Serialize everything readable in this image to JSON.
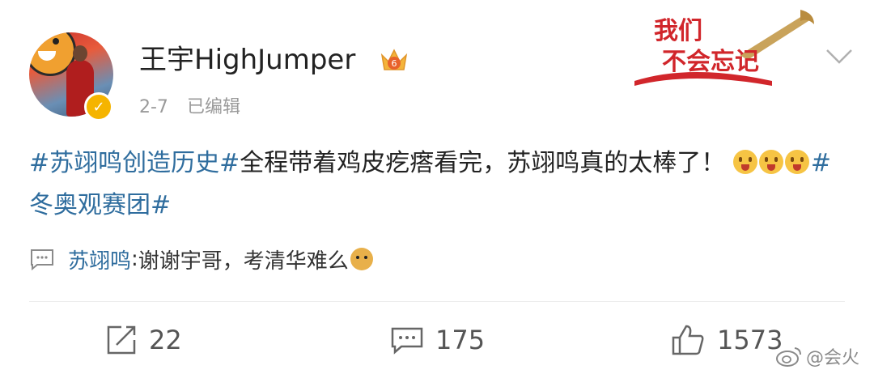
{
  "post": {
    "username": "王宇HighJumper",
    "date": "2-7",
    "edited_label": "已编辑",
    "vip_level": "6",
    "badge_text_line1": "我们",
    "badge_text_line2": "不会忘记",
    "content": {
      "tag1": "#苏翊鸣创造历史#",
      "text1": "全程带着鸡皮疙瘩看完，苏翊鸣真的太棒了！",
      "tag2": "#冬奥观赛团#"
    },
    "comment": {
      "name": "苏翊鸣",
      "separator": ": ",
      "text": "谢谢宇哥，考清华难么"
    }
  },
  "actions": {
    "repost_count": "22",
    "comment_count": "175",
    "like_count": "1573"
  },
  "watermark": {
    "text": "@会火"
  },
  "colors": {
    "link": "#2f6d9e",
    "muted": "#9a9a9a",
    "verified": "#f5b400",
    "badge_red": "#d1262b"
  },
  "icons": [
    "verified-icon",
    "crown-icon",
    "chevron-down-icon",
    "comment-bubble-icon",
    "repost-icon",
    "comment-icon",
    "like-icon",
    "weibo-logo-icon"
  ]
}
